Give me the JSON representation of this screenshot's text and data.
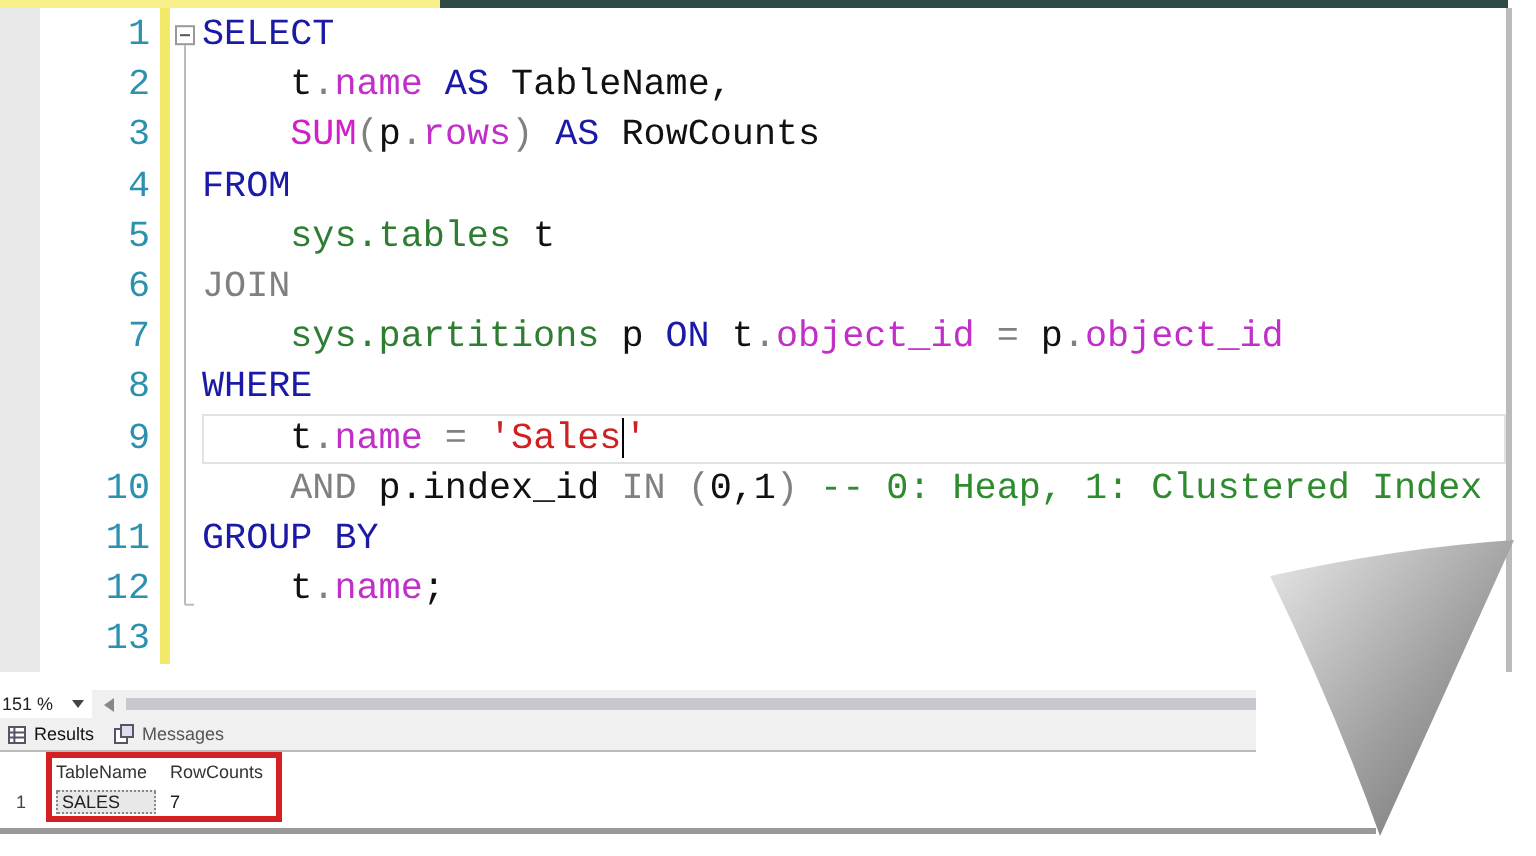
{
  "editor": {
    "lines": [
      {
        "number": "1",
        "current": false,
        "tokens": [
          {
            "text": "SELECT",
            "kind": "keyword"
          }
        ]
      },
      {
        "number": "2",
        "current": false,
        "tokens": [
          {
            "text": "    t",
            "kind": "plain"
          },
          {
            "text": ".",
            "kind": "operator"
          },
          {
            "text": "name",
            "kind": "column"
          },
          {
            "text": " AS",
            "kind": "keyword"
          },
          {
            "text": " TableName,",
            "kind": "plain"
          }
        ]
      },
      {
        "number": "3",
        "current": false,
        "tokens": [
          {
            "text": "    SUM",
            "kind": "function"
          },
          {
            "text": "(",
            "kind": "operator"
          },
          {
            "text": "p",
            "kind": "plain"
          },
          {
            "text": ".",
            "kind": "operator"
          },
          {
            "text": "rows",
            "kind": "column"
          },
          {
            "text": ") ",
            "kind": "operator"
          },
          {
            "text": "AS",
            "kind": "keyword"
          },
          {
            "text": " RowCounts",
            "kind": "plain"
          }
        ]
      },
      {
        "number": "4",
        "current": false,
        "tokens": [
          {
            "text": "FROM",
            "kind": "keyword"
          }
        ]
      },
      {
        "number": "5",
        "current": false,
        "tokens": [
          {
            "text": "    sys.tables",
            "kind": "system"
          },
          {
            "text": " t",
            "kind": "plain"
          }
        ]
      },
      {
        "number": "6",
        "current": false,
        "tokens": [
          {
            "text": "JOIN",
            "kind": "operator"
          }
        ]
      },
      {
        "number": "7",
        "current": false,
        "tokens": [
          {
            "text": "    sys.partitions",
            "kind": "system"
          },
          {
            "text": " p ",
            "kind": "plain"
          },
          {
            "text": "ON",
            "kind": "keyword"
          },
          {
            "text": " t",
            "kind": "plain"
          },
          {
            "text": ".",
            "kind": "operator"
          },
          {
            "text": "object_id",
            "kind": "column"
          },
          {
            "text": " = ",
            "kind": "operator"
          },
          {
            "text": "p",
            "kind": "plain"
          },
          {
            "text": ".",
            "kind": "operator"
          },
          {
            "text": "object_id",
            "kind": "column"
          }
        ]
      },
      {
        "number": "8",
        "current": false,
        "tokens": [
          {
            "text": "WHERE",
            "kind": "keyword"
          }
        ]
      },
      {
        "number": "9",
        "current": true,
        "tokens": [
          {
            "text": "    t",
            "kind": "plain"
          },
          {
            "text": ".",
            "kind": "operator"
          },
          {
            "text": "name",
            "kind": "column"
          },
          {
            "text": " = ",
            "kind": "operator"
          },
          {
            "text": "'Sales",
            "kind": "string",
            "caret_after": true
          },
          {
            "text": "'",
            "kind": "string"
          }
        ]
      },
      {
        "number": "10",
        "current": false,
        "tokens": [
          {
            "text": "    AND",
            "kind": "operator"
          },
          {
            "text": " p.index_id ",
            "kind": "plain"
          },
          {
            "text": "IN",
            "kind": "operator"
          },
          {
            "text": " (",
            "kind": "operator"
          },
          {
            "text": "0,1",
            "kind": "plain"
          },
          {
            "text": ")",
            "kind": "operator"
          },
          {
            "text": " -- 0: Heap, 1: Clustered Index",
            "kind": "comment"
          }
        ]
      },
      {
        "number": "11",
        "current": false,
        "tokens": [
          {
            "text": "GROUP BY",
            "kind": "keyword"
          }
        ]
      },
      {
        "number": "12",
        "current": false,
        "tokens": [
          {
            "text": "    t",
            "kind": "plain"
          },
          {
            "text": ".",
            "kind": "operator"
          },
          {
            "text": "name",
            "kind": "column"
          },
          {
            "text": ";",
            "kind": "plain"
          }
        ]
      },
      {
        "number": "13",
        "current": false
      }
    ]
  },
  "zoom": {
    "value": "151 %"
  },
  "tabs": [
    {
      "label": "Results",
      "selected": true
    },
    {
      "label": "Messages",
      "selected": false
    }
  ],
  "results": {
    "columns": [
      "TableName",
      "RowCounts"
    ],
    "rows": [
      {
        "number": "1",
        "cells": [
          "SALES",
          "7"
        ]
      }
    ]
  }
}
